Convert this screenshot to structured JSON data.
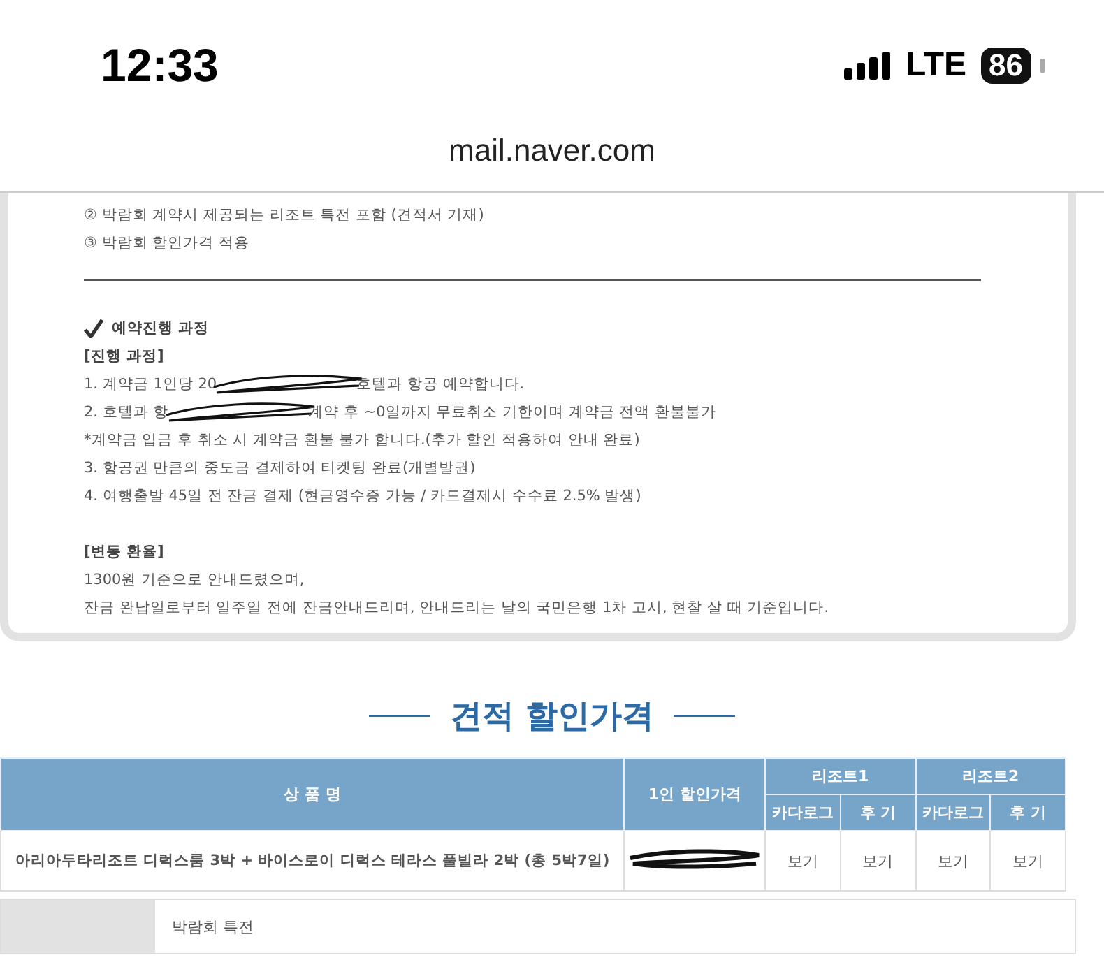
{
  "status_bar": {
    "time": "12:33",
    "network": "LTE",
    "battery": "86"
  },
  "address_bar": {
    "url": "mail.naver.com"
  },
  "card": {
    "lines": [
      {
        "kind": "text",
        "text": "② 박람회 계약시 제공되는 리조트 특전 포함 (견적서 기재)"
      },
      {
        "kind": "text",
        "text": "③ 박람회 할인가격 적용"
      },
      {
        "kind": "divider"
      },
      {
        "kind": "check_heading",
        "text": "예약진행 과정"
      },
      {
        "kind": "subheading",
        "text": "[진행 과정]"
      },
      {
        "kind": "redacted",
        "text": "1. 계약금 1인당 20",
        "after": "호텔과 항공 예약합니다."
      },
      {
        "kind": "redacted",
        "text": "2. 호텔과 항",
        "after": "계약 후 ~0일까지 무료취소 기한이며 계약금 전액 환불불가"
      },
      {
        "kind": "text",
        "text": "*계약금 입금 후 취소 시 계약금 환불 불가 합니다.(추가 할인 적용하여 안내 완료)"
      },
      {
        "kind": "text",
        "text": "3. 항공권 만큼의 중도금 결제하여 티켓팅 완료(개별발권)"
      },
      {
        "kind": "text",
        "text": "4. 여행출발 45일 전 잔금 결제 (현금영수증 가능 / 카드결제시 수수료 2.5% 발생)"
      },
      {
        "kind": "gap"
      },
      {
        "kind": "subheading",
        "text": "[변동 환율]"
      },
      {
        "kind": "text",
        "text": "1300원 기준으로 안내드렸으며,"
      },
      {
        "kind": "text",
        "text": "잔금 완납일로부터 일주일 전에 잔금안내드리며, 안내드리는 날의 국민은행 1차 고시, 현찰 살 때 기준입니다."
      }
    ]
  },
  "section_title": "견적 할인가격",
  "table": {
    "columns": [
      "상 품 명",
      "1인 할인가격"
    ],
    "groups": [
      {
        "name": "리조트1",
        "subcolumns": [
          "카다로그",
          "후 기"
        ]
      },
      {
        "name": "리조트2",
        "subcolumns": [
          "카다로그",
          "후 기"
        ]
      }
    ],
    "rows": [
      {
        "product": "아리아두타리조트 디럭스룸 3박 + 바이스로이 디럭스 테라스 풀빌라 2박 (총 5박7일)",
        "price_redacted": true,
        "links": [
          "보기",
          "보기",
          "보기",
          "보기"
        ]
      }
    ]
  },
  "benefits": {
    "label": "박람회 특전"
  }
}
